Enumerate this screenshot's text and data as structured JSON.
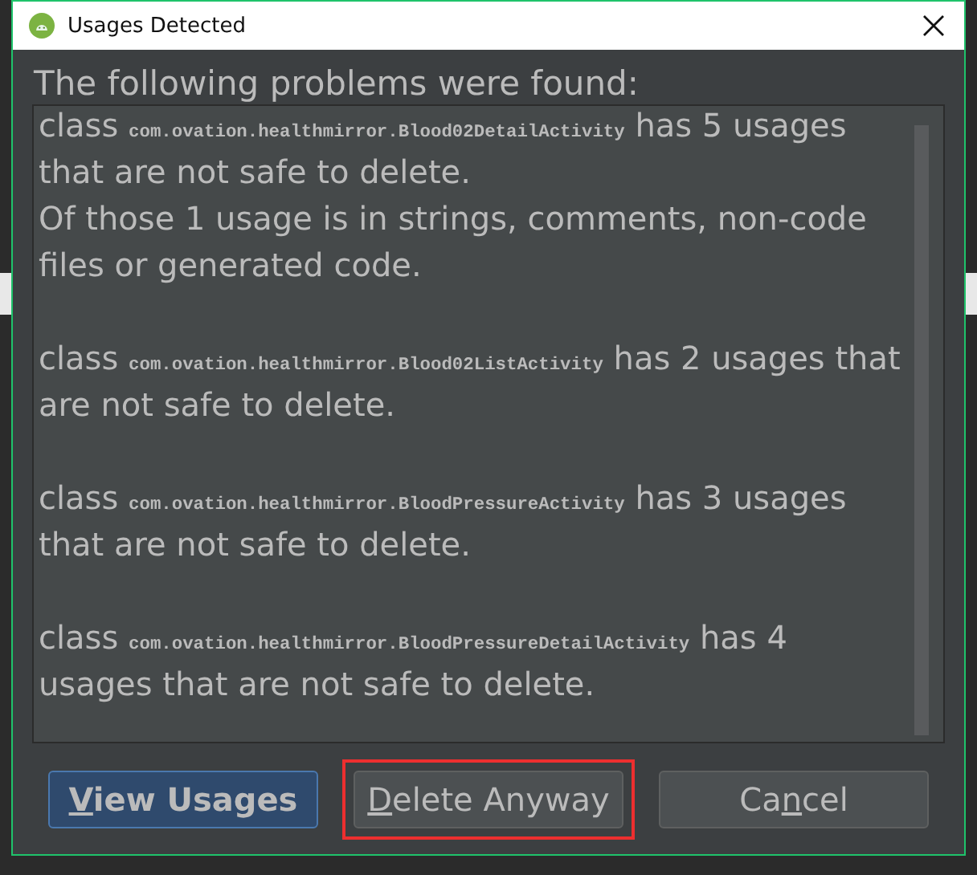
{
  "window": {
    "title": "Usages Detected"
  },
  "heading": "The following problems were found:",
  "problems": [
    {
      "prefix": "class",
      "class_name": "com.ovation.healthmirror.Blood02DetailActivity",
      "suffix": "has 5 usages that are not safe to delete.",
      "note": "Of those 1 usage is in strings, comments, non-code files or generated code."
    },
    {
      "prefix": "class",
      "class_name": "com.ovation.healthmirror.Blood02ListActivity",
      "suffix": "has 2 usages that are not safe to delete."
    },
    {
      "prefix": "class",
      "class_name": "com.ovation.healthmirror.BloodPressureActivity",
      "suffix": "has 3 usages that are not safe to delete."
    },
    {
      "prefix": "class",
      "class_name": "com.ovation.healthmirror.BloodPressureDetailActivity",
      "suffix": "has 4 usages that are not safe to delete."
    }
  ],
  "buttons": [
    {
      "mnemonic": "V",
      "after": "iew Usages",
      "kind": "default",
      "highlighted": false
    },
    {
      "mnemonic": "D",
      "after": "elete Anyway",
      "kind": "normal",
      "highlighted": true
    },
    {
      "before": "Ca",
      "mnemonic": "n",
      "after": "cel",
      "kind": "normal",
      "highlighted": false
    }
  ]
}
